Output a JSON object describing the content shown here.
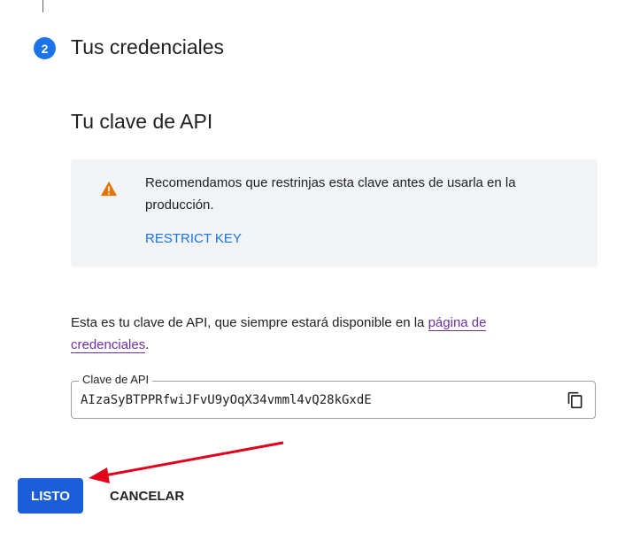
{
  "step": {
    "number": "2",
    "title": "Tus credenciales"
  },
  "api_key_section": {
    "title": "Tu clave de API",
    "notice": {
      "icon": "warning-icon",
      "message": "Recomendamos que restrinjas esta clave antes de usarla en la producción.",
      "action_label": "RESTRICT KEY"
    },
    "description_prefix": "Esta es tu clave de API, que siempre estará disponible en la ",
    "description_link": "página de credenciales",
    "description_suffix": ".",
    "field": {
      "label": "Clave de API",
      "value": "AIzaSyBTPPRfwiJFvU9yOqX34vmml4vQ28kGxdE",
      "copy_icon": "copy-icon"
    }
  },
  "actions": {
    "done_label": "LISTO",
    "cancel_label": "CANCELAR"
  },
  "colors": {
    "accent": "#1a73e8",
    "warning": "#e37400",
    "annotation_arrow": "#e3001b"
  }
}
